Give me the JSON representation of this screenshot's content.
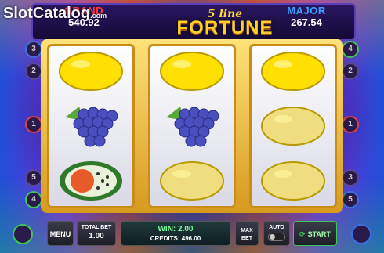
{
  "watermark": {
    "text": "SlotCatalog",
    "suffix": ".com"
  },
  "jackpots": {
    "grand": {
      "label": "GRAND",
      "value": "540.92"
    },
    "major": {
      "label": "MAJOR",
      "value": "267.54"
    }
  },
  "logo": {
    "line1": "5 line",
    "line2": "FORTUNE"
  },
  "reels": [
    [
      "lemon",
      "grapes",
      "watermelon"
    ],
    [
      "lemon",
      "grapes",
      "lemon"
    ],
    [
      "lemon",
      "lemon",
      "lemon"
    ]
  ],
  "paylines": {
    "left": [
      "3",
      "2",
      "1",
      "5",
      "4"
    ],
    "right": [
      "4",
      "2",
      "1",
      "3",
      "5"
    ]
  },
  "controls": {
    "menu": "MENU",
    "total_bet_label": "TOTAL BET",
    "total_bet_value": "1.00",
    "win": "WIN: 2.00",
    "credits": "CREDITS: 496.00",
    "max_bet_1": "MAX",
    "max_bet_2": "BET",
    "auto": "AUTO",
    "start": "START"
  },
  "colors": {
    "accent": "#ffcf2a",
    "grand": "#ff3b3b",
    "major": "#3aa0ff",
    "start": "#3fc45a"
  }
}
